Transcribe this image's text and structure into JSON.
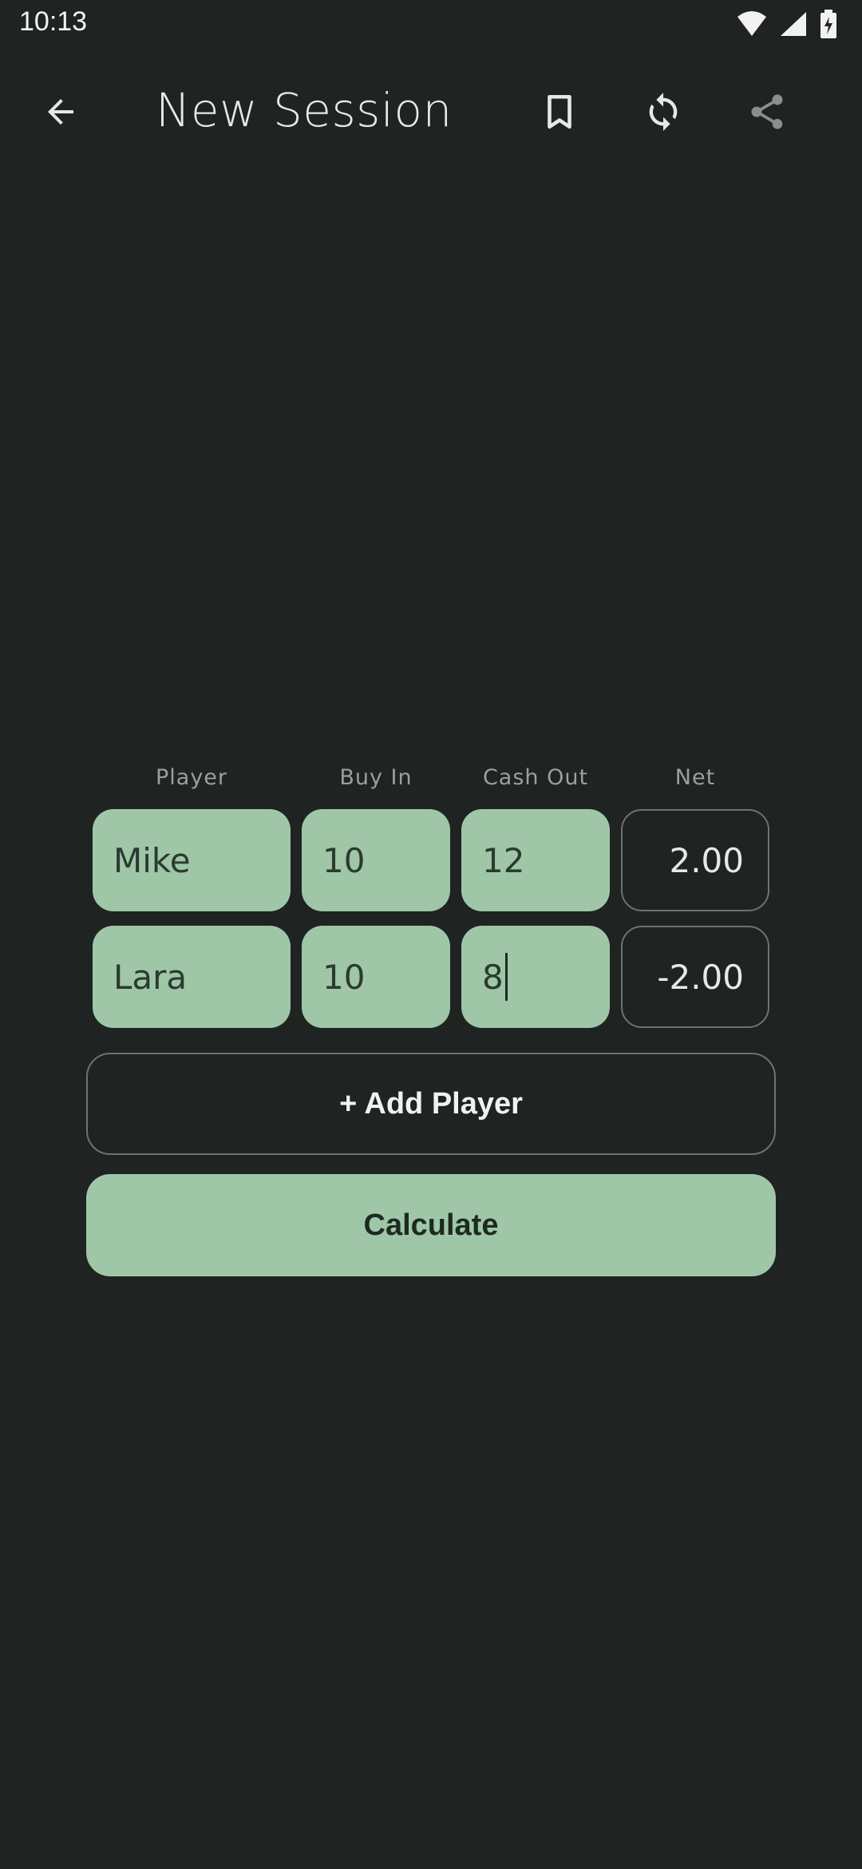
{
  "status_bar": {
    "time": "10:13"
  },
  "app_bar": {
    "title": "New Session"
  },
  "table": {
    "headers": [
      "Player",
      "Buy In",
      "Cash Out",
      "Net"
    ],
    "rows": [
      {
        "player": "Mike",
        "buy_in": "10",
        "cash_out": "12",
        "net": "2.00"
      },
      {
        "player": "Lara",
        "buy_in": "10",
        "cash_out": "8",
        "net": "-2.00"
      }
    ]
  },
  "buttons": {
    "add_player": "+ Add Player",
    "calculate": "Calculate"
  },
  "colors": {
    "background": "#1f2321",
    "accent": "#9fc7a7",
    "accent_text": "#2b3a30",
    "outline": "#6e7370"
  }
}
